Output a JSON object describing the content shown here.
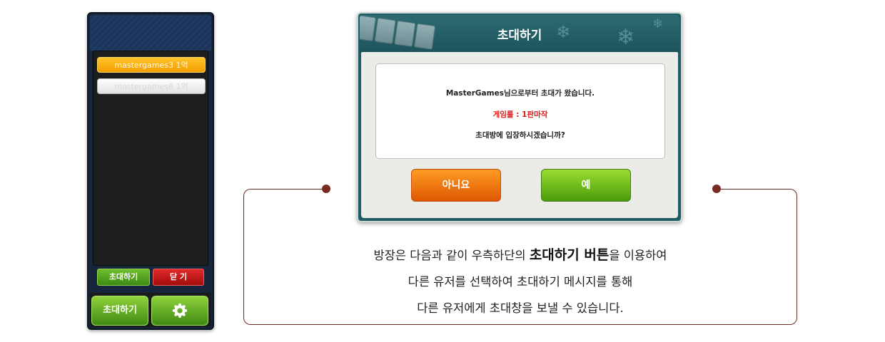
{
  "side_panel": {
    "users": [
      {
        "label": "mastergames3 1억"
      },
      {
        "label": "mastergames6 1억"
      }
    ],
    "invite_small_label": "초대하기",
    "close_label": "닫 기",
    "invite_big_label": "초대하기",
    "settings_icon": "gear-icon"
  },
  "dialog": {
    "title": "초대하기",
    "message_line1": "MasterGames님으로부터 초대가 왔습니다.",
    "message_line2": "게임룰 : 1판마작",
    "message_line3": "초대방에 입장하시겠습니까?",
    "no_label": "아니요",
    "yes_label": "예"
  },
  "caption": {
    "line1_pre": "방장은 다음과 같이 우측하단의 ",
    "line1_highlight": "초대하기 버튼",
    "line1_post": "을 이용하여",
    "line2": "다른 유저를 선택하여 초대하기 메시지를 통해",
    "line3": "다른 유저에게 초대창을 보낼 수 있습니다."
  },
  "colors": {
    "accent_orange": "#f39d00",
    "accent_green": "#4a9c0c",
    "alert_red": "#e01818",
    "connector": "#6b2a22"
  }
}
